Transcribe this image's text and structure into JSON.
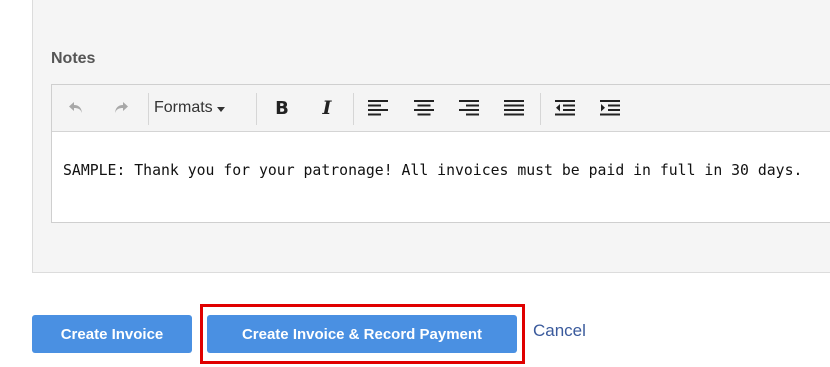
{
  "notes": {
    "label": "Notes",
    "content": "SAMPLE: Thank you for your patronage! All invoices must be paid in full in 30 days."
  },
  "toolbar": {
    "formats_label": "Formats",
    "bold_glyph": "B",
    "italic_glyph": "I"
  },
  "actions": {
    "create_invoice_label": "Create Invoice",
    "create_and_record_label": "Create Invoice & Record Payment",
    "cancel_label": "Cancel"
  },
  "colors": {
    "primary_button": "#4a90e2",
    "highlight_border": "#e00000",
    "link": "#3a5a9c"
  }
}
